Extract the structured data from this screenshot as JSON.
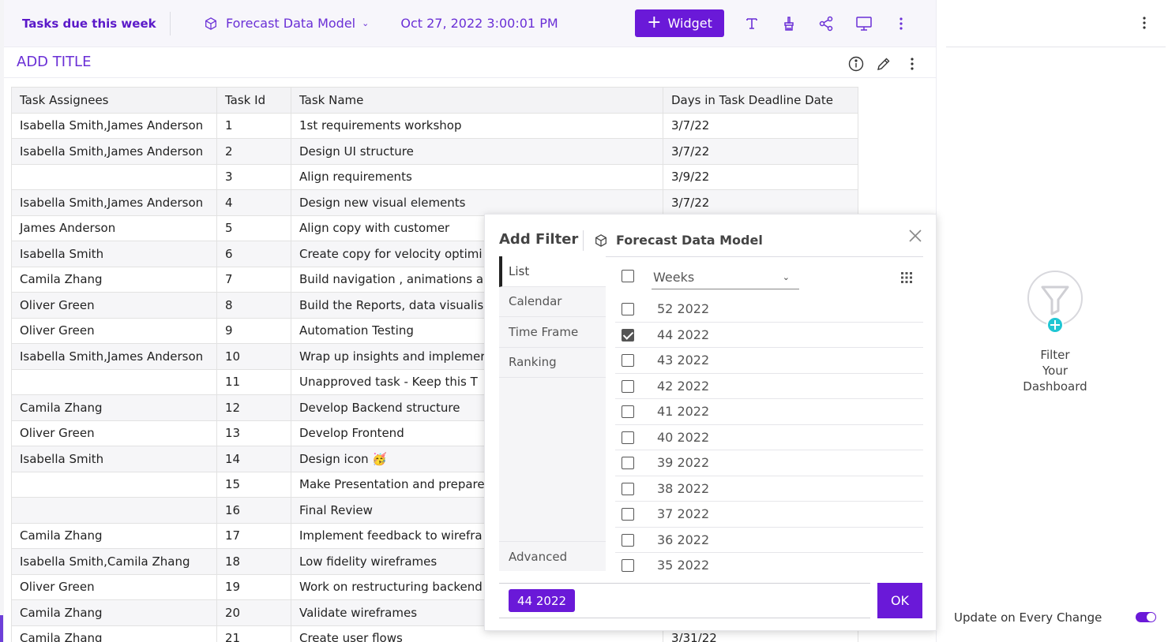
{
  "header": {
    "dashboard_title": "Tasks due this week",
    "model_name": "Forecast Data Model",
    "datetime": "Oct 27, 2022 3:00:01 PM",
    "widget_button": "Widget",
    "accent_color": "#6a19d8"
  },
  "widget": {
    "title": "ADD TITLE"
  },
  "table": {
    "columns": [
      "Task Assignees",
      "Task Id",
      "Task Name",
      "Days in Task Deadline Date"
    ],
    "rows": [
      [
        "Isabella Smith,James Anderson",
        "1",
        "1st requirements workshop",
        "3/7/22"
      ],
      [
        "Isabella Smith,James Anderson",
        "2",
        "Design UI structure",
        "3/7/22"
      ],
      [
        "",
        "3",
        "Align requirements",
        "3/9/22"
      ],
      [
        "Isabella Smith,James Anderson",
        "4",
        "Design new visual elements",
        "3/7/22"
      ],
      [
        "James Anderson",
        "5",
        "Align copy with customer",
        ""
      ],
      [
        "Isabella Smith",
        "6",
        "Create copy for velocity optimi",
        ""
      ],
      [
        "Camila Zhang",
        "7",
        "Build navigation , animations ar",
        ""
      ],
      [
        "Oliver Green",
        "8",
        "Build the Reports, data visualis",
        ""
      ],
      [
        "Oliver Green",
        "9",
        "Automation Testing",
        ""
      ],
      [
        "Isabella Smith,James Anderson",
        "10",
        "Wrap up insights and implemer",
        ""
      ],
      [
        "",
        "11",
        "Unapproved task - Keep this T",
        ""
      ],
      [
        "Camila Zhang",
        "12",
        "Develop Backend structure",
        ""
      ],
      [
        "Oliver Green",
        "13",
        "Develop Frontend",
        ""
      ],
      [
        "Isabella Smith",
        "14",
        "Design icon 🥳",
        ""
      ],
      [
        "",
        "15",
        "Make Presentation and prepare",
        ""
      ],
      [
        "",
        "16",
        "Final Review",
        ""
      ],
      [
        "Camila Zhang",
        "17",
        "Implement feedback to wirefra",
        ""
      ],
      [
        "Isabella Smith,Camila Zhang",
        "18",
        "Low fidelity wireframes",
        ""
      ],
      [
        "Oliver Green",
        "19",
        "Work on restructuring backend",
        ""
      ],
      [
        "Camila Zhang",
        "20",
        "Validate wireframes",
        ""
      ],
      [
        "Camila Zhang",
        "21",
        "Create user flows",
        "3/31/22"
      ]
    ]
  },
  "filter_dialog": {
    "title": "Add Filter",
    "model_name": "Forecast Data Model",
    "tabs": [
      "List",
      "Calendar",
      "Time Frame",
      "Ranking"
    ],
    "advanced_tab": "Advanced",
    "dimension": "Weeks",
    "options": [
      {
        "label": "52 2022",
        "checked": false
      },
      {
        "label": "44 2022",
        "checked": true
      },
      {
        "label": "43 2022",
        "checked": false
      },
      {
        "label": "42 2022",
        "checked": false
      },
      {
        "label": "41 2022",
        "checked": false
      },
      {
        "label": "40 2022",
        "checked": false
      },
      {
        "label": "39 2022",
        "checked": false
      },
      {
        "label": "38 2022",
        "checked": false
      },
      {
        "label": "37 2022",
        "checked": false
      },
      {
        "label": "36 2022",
        "checked": false
      },
      {
        "label": "35 2022",
        "checked": false
      }
    ],
    "selected_chip": "44 2022",
    "ok_label": "OK"
  },
  "right_panel": {
    "filter_prompt": [
      "Filter",
      "Your",
      "Dashboard"
    ],
    "update_label": "Update on Every Change",
    "update_enabled": true
  }
}
